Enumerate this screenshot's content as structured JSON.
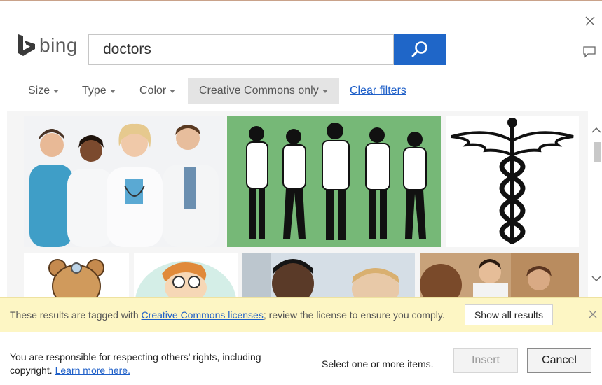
{
  "brand": {
    "name": "bing"
  },
  "search": {
    "value": "doctors"
  },
  "filters": {
    "size": "Size",
    "type": "Type",
    "color": "Color",
    "license": "Creative Commons only",
    "clear": "Clear filters"
  },
  "results": [
    {
      "icon": "doctors-team-photo"
    },
    {
      "icon": "doctor-silhouettes-green"
    },
    {
      "icon": "caduceus-symbol"
    },
    {
      "icon": "teddy-bear-doctor-cartoon"
    },
    {
      "icon": "cartoon-doctor-glasses"
    },
    {
      "icon": "smiling-doctor-photo"
    },
    {
      "icon": "doctors-with-patient-photo"
    }
  ],
  "notice": {
    "prefix": "These results are tagged with ",
    "link": "Creative Commons licenses",
    "suffix": "; review the license to ensure you comply.",
    "show_all": "Show all results"
  },
  "footer": {
    "rights_text": "You are responsible for respecting others' rights, including copyright.",
    "learn_more": "Learn more here.",
    "select_hint": "Select one or more items.",
    "insert": "Insert",
    "cancel": "Cancel"
  },
  "colors": {
    "search_button": "#1f66c8",
    "link": "#1e5fc8",
    "notice_bg": "#fdf6c4",
    "thumb_green": "#76b877"
  }
}
